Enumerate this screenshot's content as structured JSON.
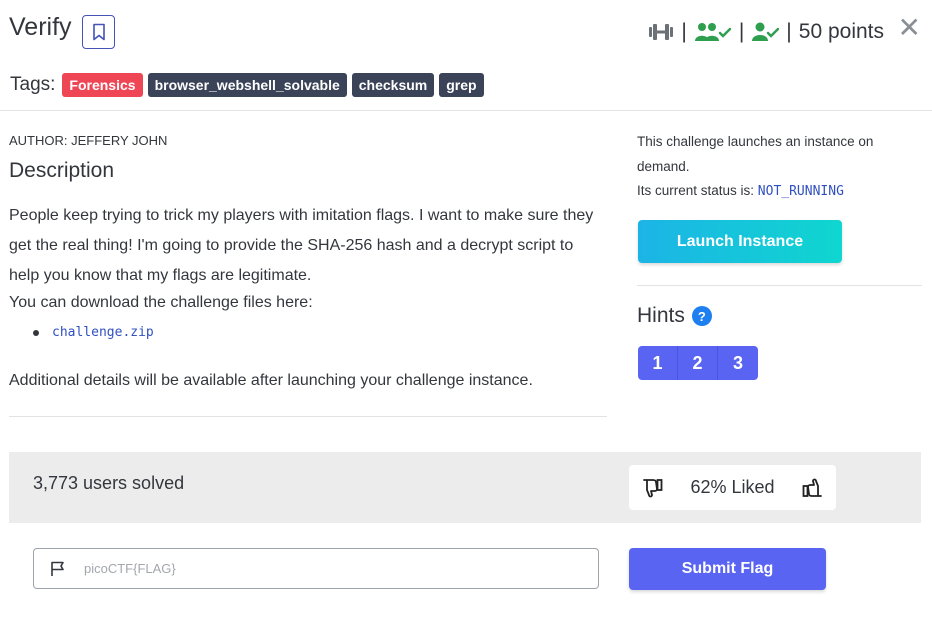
{
  "challenge": {
    "title": "Verify",
    "points": "50 points",
    "tags_label": "Tags:",
    "tags": [
      "Forensics",
      "browser_webshell_solvable",
      "checksum",
      "grep"
    ],
    "author": "AUTHOR: JEFFERY JOHN",
    "description_heading": "Description",
    "description": "People keep trying to trick my players with imitation flags. I want to make sure they get the real thing! I'm going to provide the SHA-256 hash and a decrypt script to help you know that my flags are legitimate.",
    "download_text": "You can download the challenge files here:",
    "file_link": "challenge.zip",
    "additional_text": "Additional details will be available after launching your challenge instance."
  },
  "instance": {
    "launch_text": "This challenge launches an instance on demand.",
    "status_label": "Its current status is: ",
    "status_value": "NOT_RUNNING",
    "launch_button": "Launch Instance"
  },
  "hints": {
    "heading": "Hints",
    "items": [
      "1",
      "2",
      "3"
    ]
  },
  "stats": {
    "solved": "3,773 users solved",
    "liked": "62% Liked"
  },
  "flag": {
    "placeholder": "picoCTF{FLAG}",
    "submit_label": "Submit Flag"
  },
  "colors": {
    "primary": "#5a64f2",
    "tag_red": "#ef4655",
    "tag_dark": "#3a4357",
    "success_green": "#2e9e4f",
    "link_blue": "#3050c0"
  },
  "icons": [
    "bookmark-icon",
    "dumbbell-icon",
    "users-check-icon",
    "user-check-icon",
    "close-icon",
    "question-icon",
    "thumbs-down-icon",
    "thumbs-up-icon",
    "flag-icon"
  ]
}
